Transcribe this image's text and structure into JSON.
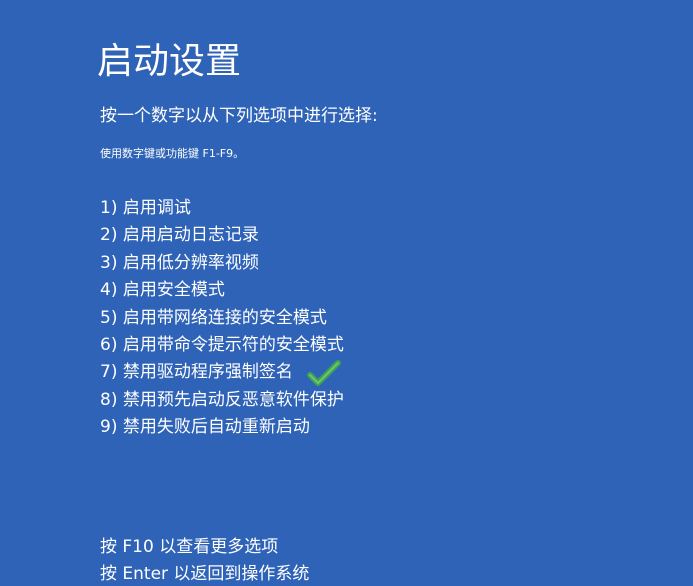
{
  "page": {
    "title": "启动设置",
    "instruction": "按一个数字以从下列选项中进行选择:",
    "hint": "使用数字键或功能键 F1-F9。"
  },
  "options": [
    {
      "label": "1) 启用调试"
    },
    {
      "label": "2) 启用启动日志记录"
    },
    {
      "label": "3) 启用低分辨率视频"
    },
    {
      "label": "4) 启用安全模式"
    },
    {
      "label": "5) 启用带网络连接的安全模式"
    },
    {
      "label": "6) 启用带命令提示符的安全模式"
    },
    {
      "label": "7) 禁用驱动程序强制签名",
      "icon": "green-check-icon"
    },
    {
      "label": "8) 禁用预先启动反恶意软件保护"
    },
    {
      "label": "9) 禁用失败后自动重新启动"
    }
  ],
  "footer": {
    "more_options": "按 F10 以查看更多选项",
    "return_os": "按 Enter 以返回到操作系统"
  },
  "colors": {
    "background": "#2f63b7",
    "text": "#ffffff",
    "check_mark": "#3fa34d"
  }
}
